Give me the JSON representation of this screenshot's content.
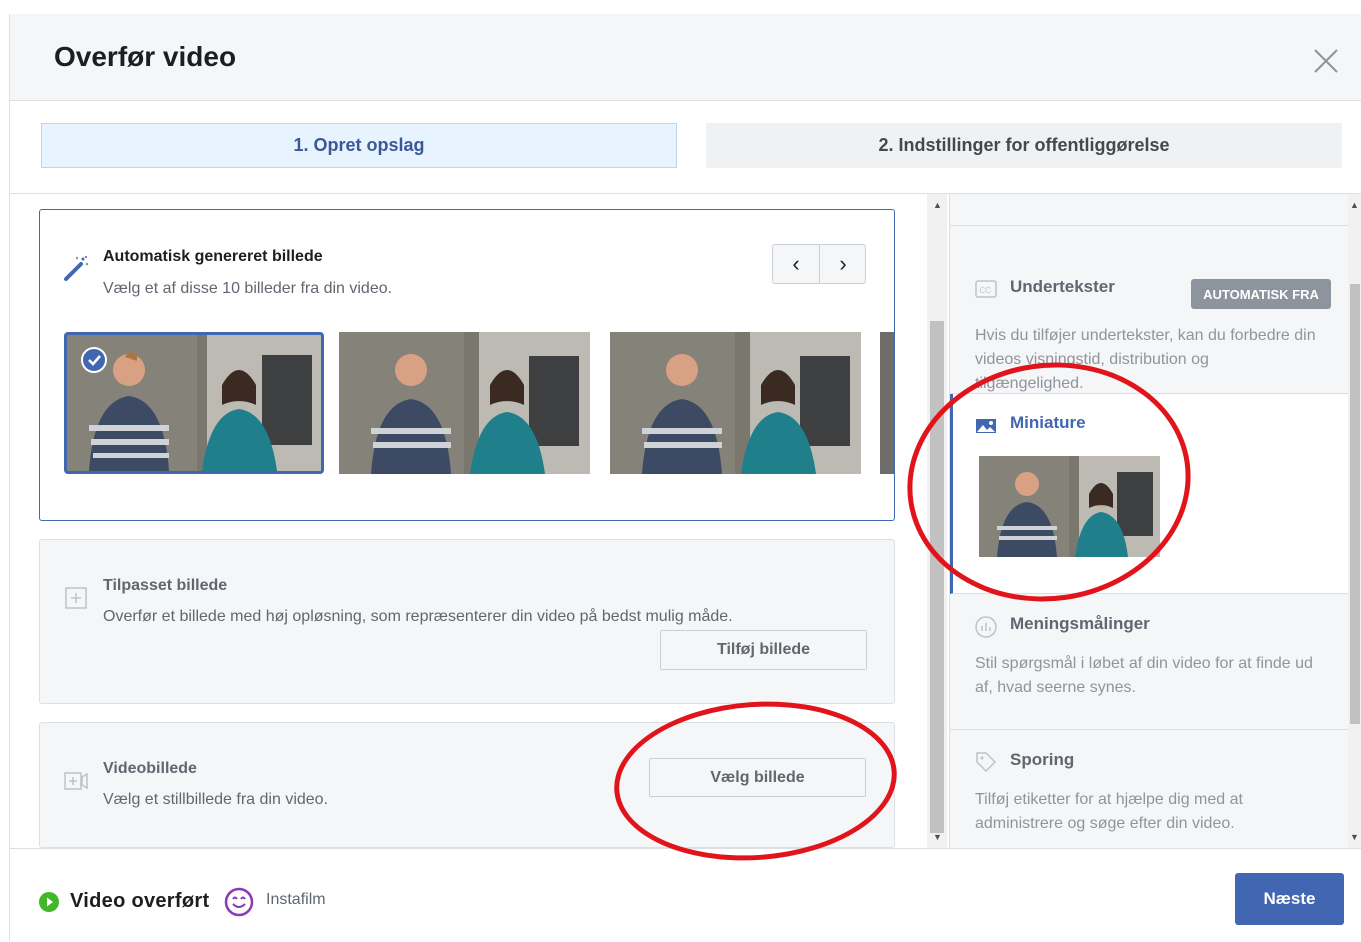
{
  "dialog": {
    "title": "Overfør video"
  },
  "steps": [
    {
      "label": "1. Opret opslag"
    },
    {
      "label": "2. Indstillinger for offentliggørelse"
    }
  ],
  "thumbnail_options": {
    "auto": {
      "title": "Automatisk genereret billede",
      "subtitle": "Vælg et af disse 10 billeder fra din video."
    },
    "custom": {
      "title": "Tilpasset billede",
      "subtitle": "Overfør et billede med høj opløsning, som repræsenterer din video på bedst mulig måde.",
      "button": "Tilføj billede"
    },
    "video_frame": {
      "title": "Videobillede",
      "subtitle": "Vælg et stillbillede fra din video.",
      "button": "Vælg billede"
    }
  },
  "side_panel": {
    "captions": {
      "title": "Undertekster",
      "badge": "AUTOMATISK FRA",
      "description": "Hvis du tilføjer undertekster, kan du forbedre din videos visningstid, distribution og tilgængelighed."
    },
    "thumbnail": {
      "title": "Miniature"
    },
    "polls": {
      "title": "Meningsmålinger",
      "description": "Stil spørgsmål i løbet af din video for at finde ud af, hvad seerne synes."
    },
    "tracking": {
      "title": "Sporing",
      "description": "Tilføj etiketter for at hjælpe dig med at administrere og søge efter din video."
    }
  },
  "footer": {
    "status": "Video overført",
    "instafilm": "Instafilm",
    "next_button": "Næste"
  },
  "colors": {
    "accent": "#4267b2",
    "highlight_circle": "#e0141a",
    "success": "#42b72a"
  }
}
